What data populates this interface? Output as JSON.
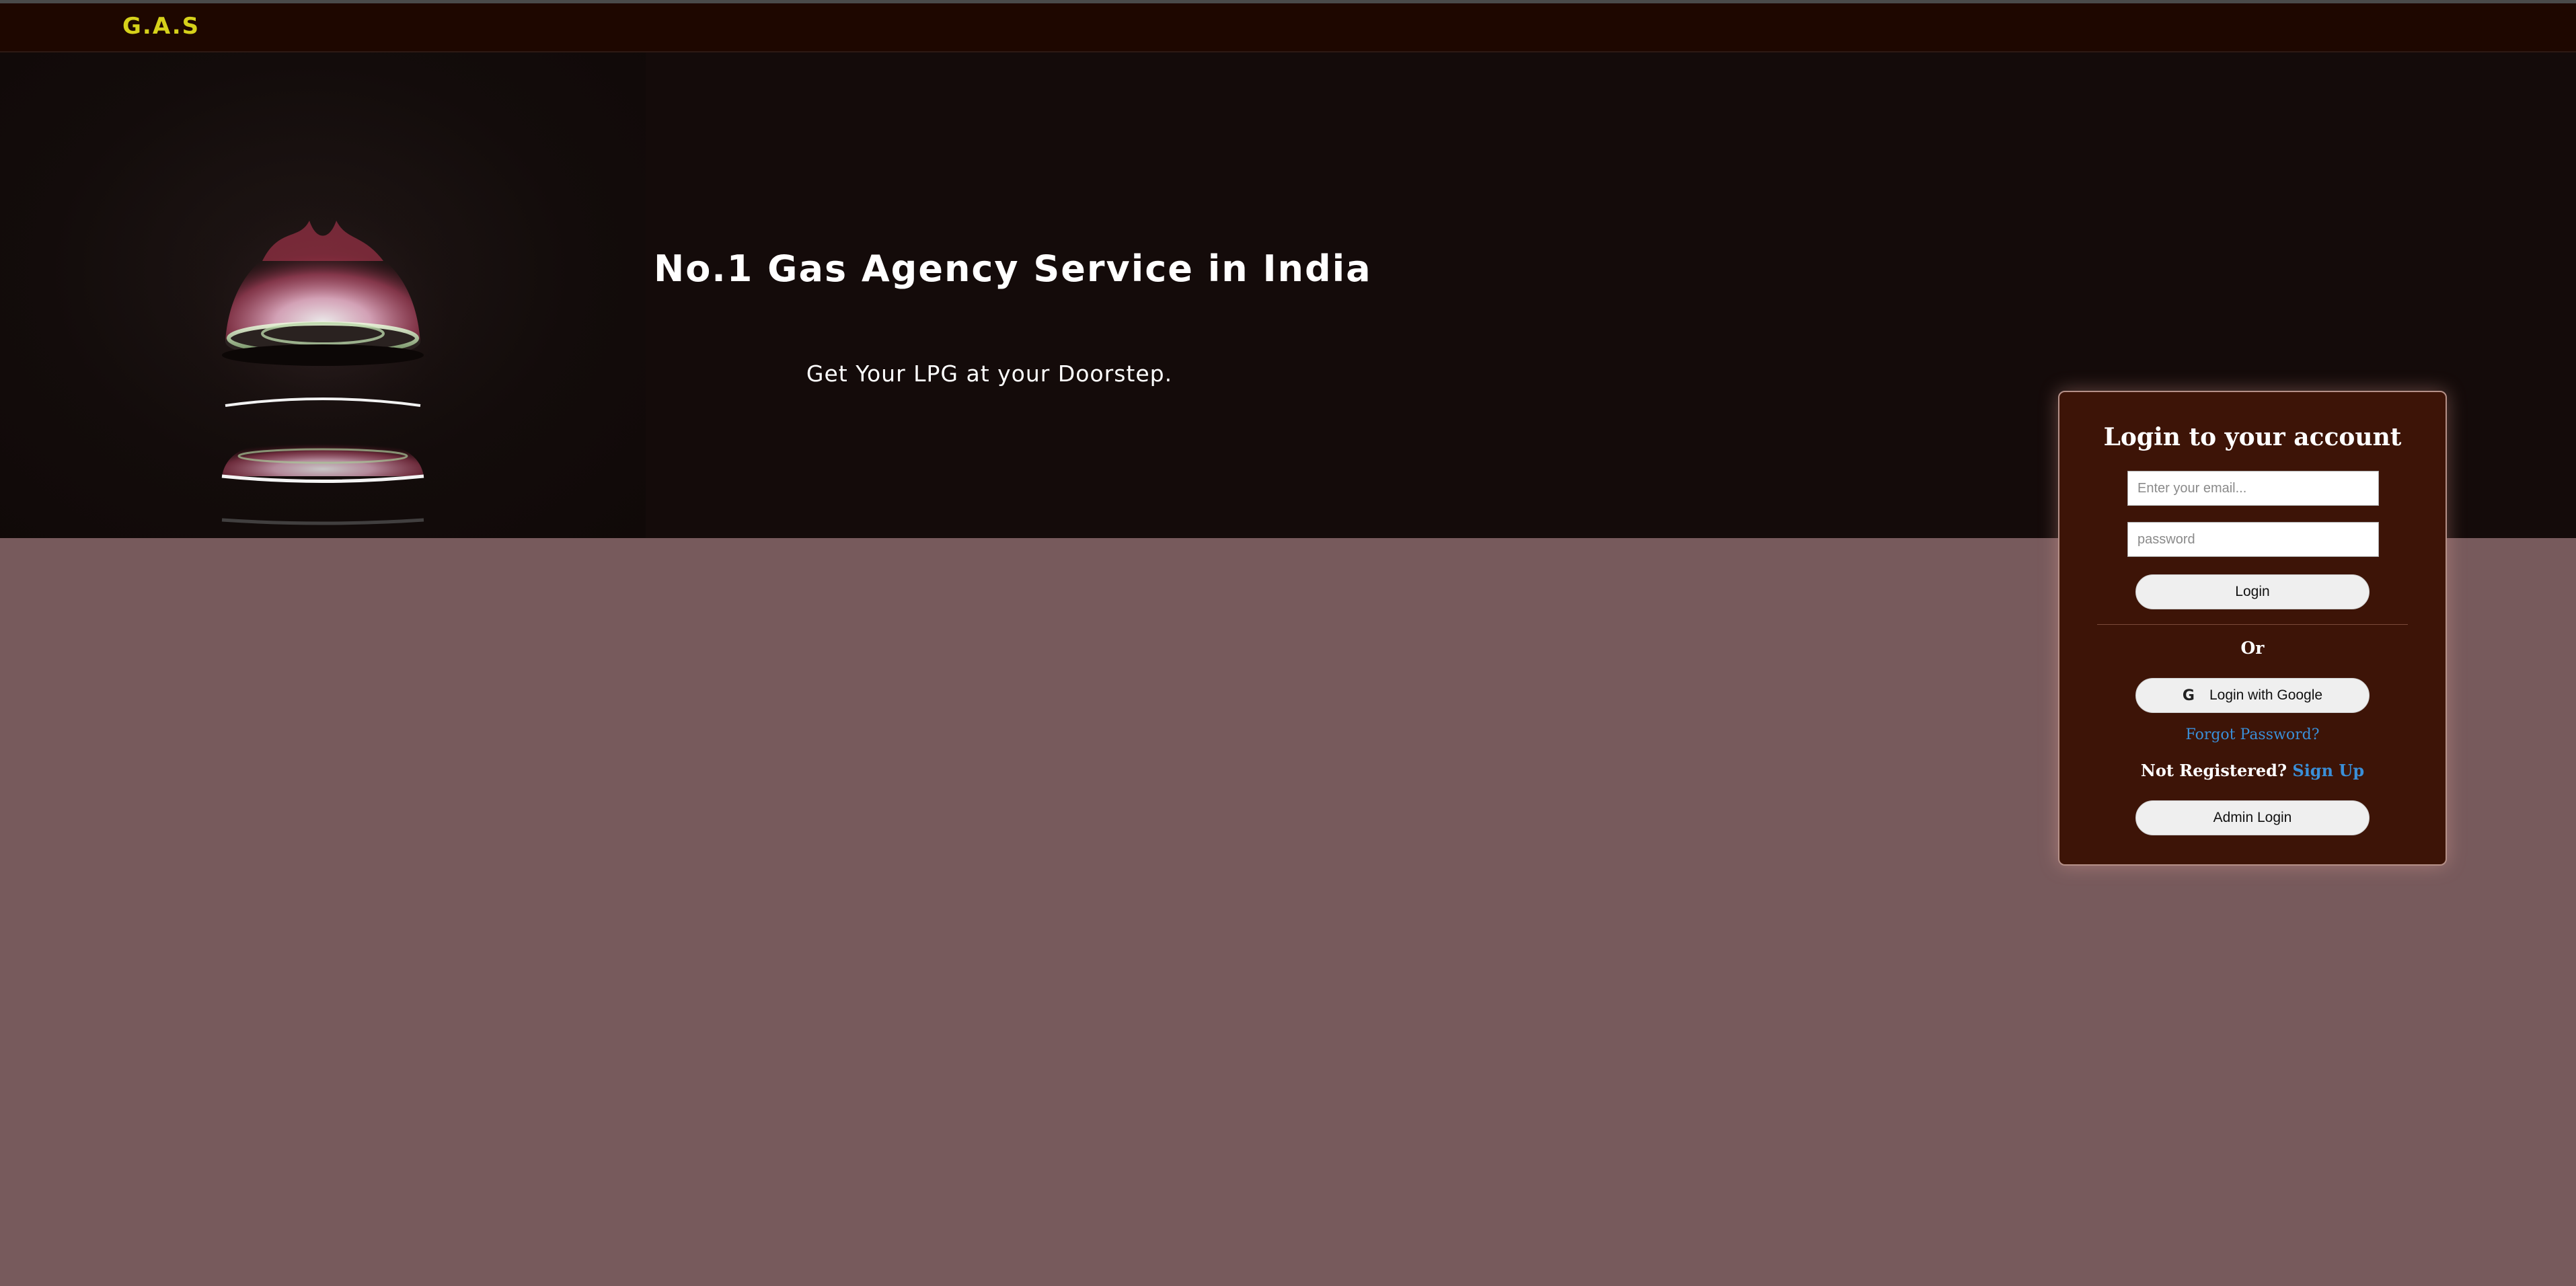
{
  "navbar": {
    "brand": "G.A.S"
  },
  "hero": {
    "title": "No.1 Gas Agency Service in India",
    "subtitle": "Get Your LPG at your Doorstep."
  },
  "login": {
    "title": "Login to your account",
    "email_placeholder": "Enter your email...",
    "password_placeholder": "password",
    "login_button": "Login",
    "or_text": "Or",
    "google_icon": "G",
    "google_button": "Login with Google",
    "forgot_password": "Forgot Password?",
    "not_registered": "Not Registered?",
    "sign_up": "Sign Up",
    "admin_button": "Admin Login"
  },
  "colors": {
    "navbar_bg": "#1e0700",
    "brand": "#d6d11a",
    "page_bg": "#775a5c",
    "card_bg": "#3d1407",
    "link": "#3a8fd8"
  }
}
